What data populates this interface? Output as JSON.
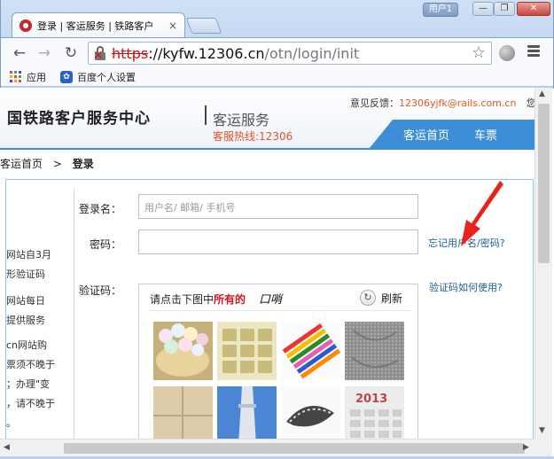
{
  "window": {
    "user_label": "用户1",
    "controls": [
      "—",
      "❐",
      "✕"
    ]
  },
  "tab": {
    "title": "登录 | 客运服务 | 铁路客户",
    "close": "×"
  },
  "toolbar": {
    "url_proto": "https",
    "url_host": "://kyfw.12306.cn",
    "url_path": "/otn/login/init"
  },
  "bookmarks": [
    {
      "label": "应用"
    },
    {
      "label": "百度个人设置"
    }
  ],
  "header": {
    "brand": "国铁路客户服务中心",
    "subbrand": "客运服务",
    "hotline": "客服热线:12306",
    "feedback_label": "意见反馈：",
    "feedback_email": "12306yjfk@rails.com.cn",
    "feedback_tail": "您",
    "nav": [
      "客运首页",
      "车票"
    ]
  },
  "breadcrumb": {
    "home": "客运首页",
    "sep": ">",
    "current": "登录"
  },
  "left_notice": [
    "网站自3月",
    "形验证码",
    "",
    "网站每日",
    "提供服务",
    "",
    "cn网站购",
    "票须不晚于",
    "；办理\"变",
    "，请不晚于",
    "。"
  ],
  "form": {
    "username_label": "登录名：",
    "username_placeholder": "用户名/ 邮箱/ 手机号",
    "password_label": "密码：",
    "captcha_label": "验证码：",
    "forgot_link": "忘记用户名/密码?",
    "captcha_help_link": "验证码如何使用?"
  },
  "captcha": {
    "prompt_prefix": "请点击下图中",
    "prompt_highlight": "所有的",
    "target_word": "口哨",
    "refresh_label": "刷新",
    "tiles": [
      {
        "name": "marshmallows-image"
      },
      {
        "name": "calendar-image"
      },
      {
        "name": "crayons-image"
      },
      {
        "name": "carpet-image"
      },
      {
        "name": "tiles-image"
      },
      {
        "name": "tower-image"
      },
      {
        "name": "bracelet-image"
      },
      {
        "name": "calendar-2013-image",
        "text": "2013"
      }
    ]
  }
}
